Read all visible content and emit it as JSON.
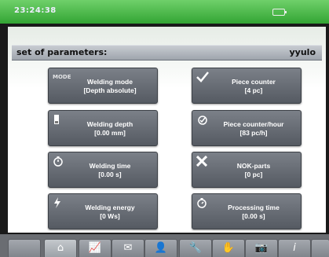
{
  "status_bar": {
    "time": "23:24:38",
    "battery_icon": "battery-icon"
  },
  "parameters": {
    "label": "set of parameters:",
    "name": "yyulo"
  },
  "tiles_left": [
    {
      "title": "Welding mode",
      "value": "[Depth absolute]",
      "icon": "mode-text-icon",
      "icon_text": "MODE"
    },
    {
      "title": "Welding depth",
      "value": "[0.00 mm]",
      "icon": "depth-gauge-icon"
    },
    {
      "title": "Welding time",
      "value": "[0.00 s]",
      "icon": "stopwatch-icon"
    },
    {
      "title": "Welding energy",
      "value": "[0 Ws]",
      "icon": "lightning-icon"
    }
  ],
  "tiles_right": [
    {
      "title": "Piece counter",
      "value": "[4 pc]",
      "icon": "checkmark-icon"
    },
    {
      "title": "Piece counter/hour",
      "value": "[83 pc/h]",
      "icon": "counter-clock-icon"
    },
    {
      "title": "NOK-parts",
      "value": "[0 pc]",
      "icon": "cross-icon"
    },
    {
      "title": "Processing time",
      "value": "[0.00 s]",
      "icon": "processing-stopwatch-icon"
    }
  ],
  "bottom_tabs": [
    {
      "icon": "blank-tab-icon",
      "glyph": ""
    },
    {
      "icon": "home-icon",
      "glyph": "⌂"
    },
    {
      "icon": "chart-icon",
      "glyph": "📈"
    },
    {
      "icon": "mail-icon",
      "glyph": "✉"
    },
    {
      "icon": "user-icon",
      "glyph": "👤"
    },
    {
      "icon": "wrench-icon",
      "glyph": "🔧"
    },
    {
      "icon": "hand-icon",
      "glyph": "✋"
    },
    {
      "icon": "camera-icon",
      "glyph": "📷"
    },
    {
      "icon": "info-icon",
      "glyph": "i"
    },
    {
      "icon": "blank-tab-icon-2",
      "glyph": ""
    }
  ],
  "colors": {
    "status_green": "#3fb23e",
    "tile_gray": "#6a6f77"
  }
}
